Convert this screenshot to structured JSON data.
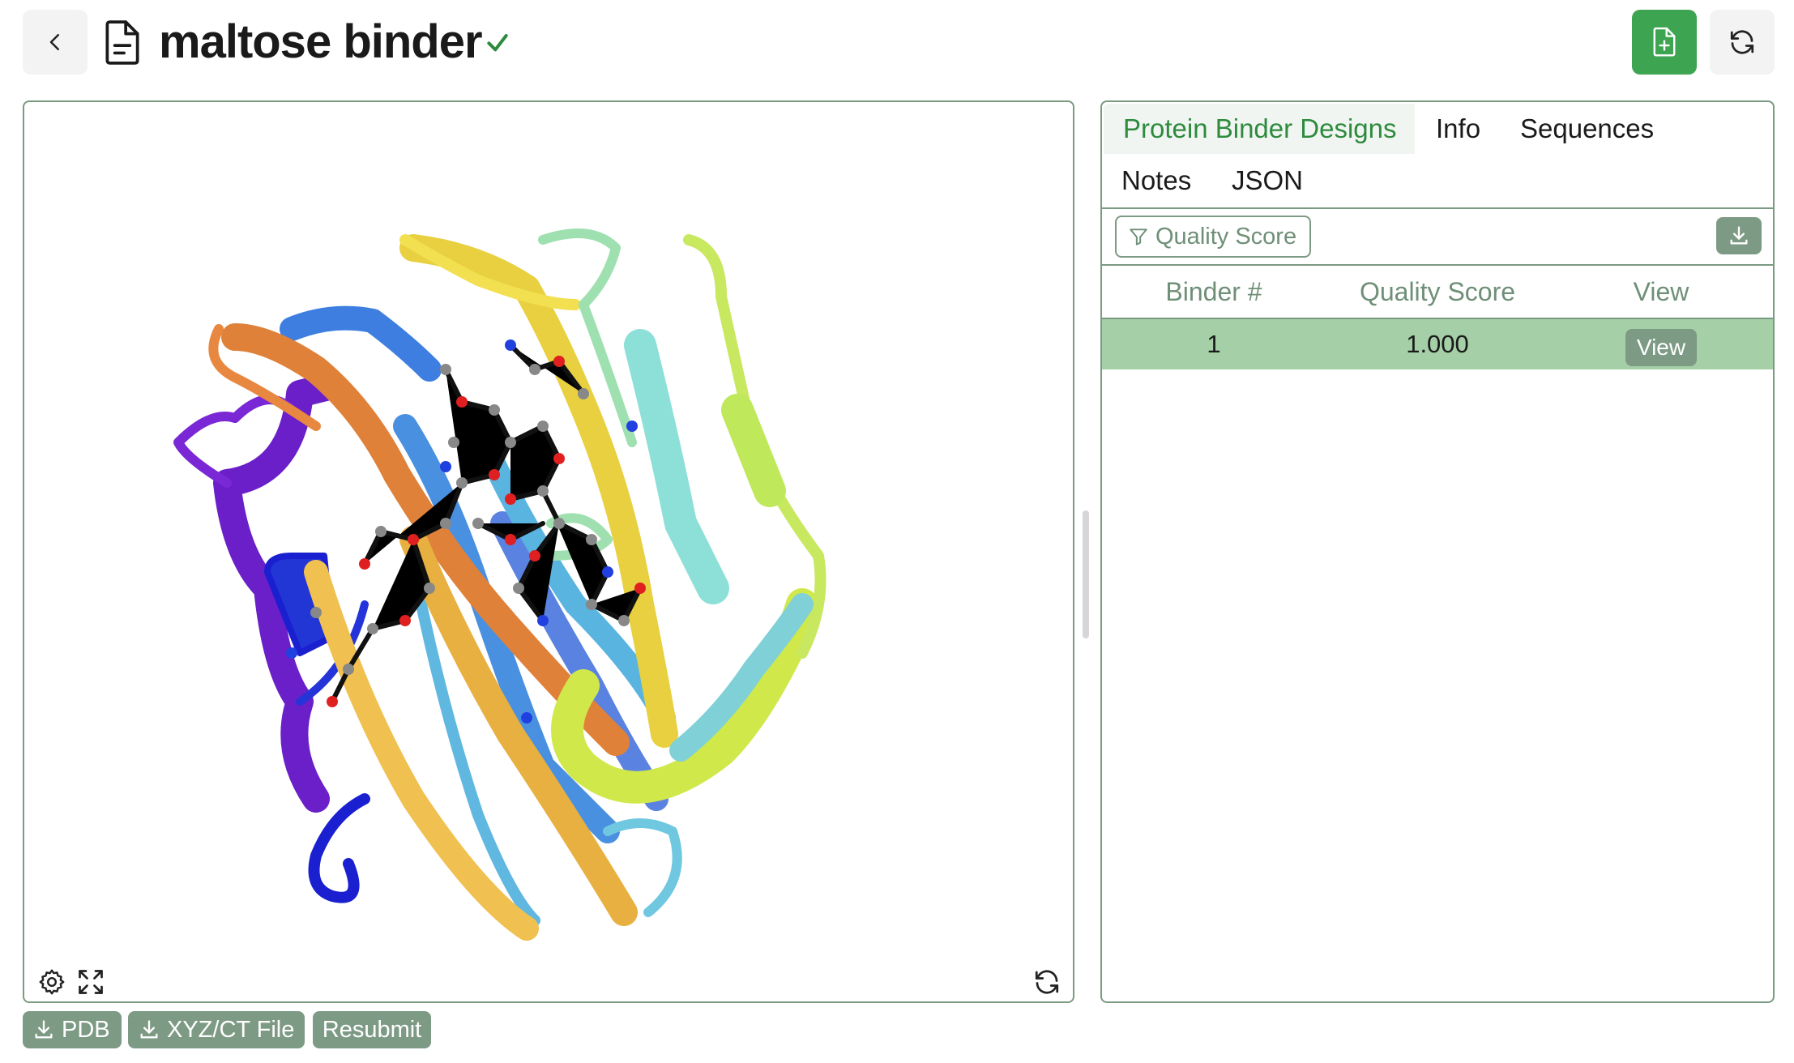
{
  "header": {
    "title": "maltose binder",
    "status_icon": "check-icon",
    "back_icon": "chevron-left-icon",
    "new_icon": "file-plus-icon",
    "refresh_icon": "refresh-icon"
  },
  "viewer": {
    "controls": [
      "settings-icon",
      "expand-icon",
      "refresh-icon"
    ],
    "buttons": {
      "pdb": "PDB",
      "xyz": "XYZ/CT File",
      "resubmit": "Resubmit"
    }
  },
  "results": {
    "tabs": [
      {
        "label": "Protein Binder Designs",
        "active": true
      },
      {
        "label": "Info",
        "active": false
      },
      {
        "label": "Sequences",
        "active": false
      },
      {
        "label": "Notes",
        "active": false
      },
      {
        "label": "JSON",
        "active": false
      }
    ],
    "filter_label": "Quality Score",
    "columns": [
      "Binder #",
      "Quality Score",
      "View"
    ],
    "rows": [
      {
        "binder": "1",
        "score": "1.000",
        "view_label": "View"
      }
    ]
  },
  "colors": {
    "accent": "#3da451",
    "muted_green": "#7d9a84",
    "selected_row": "#a5cfa7",
    "active_tab_text": "#2e8b3e"
  }
}
